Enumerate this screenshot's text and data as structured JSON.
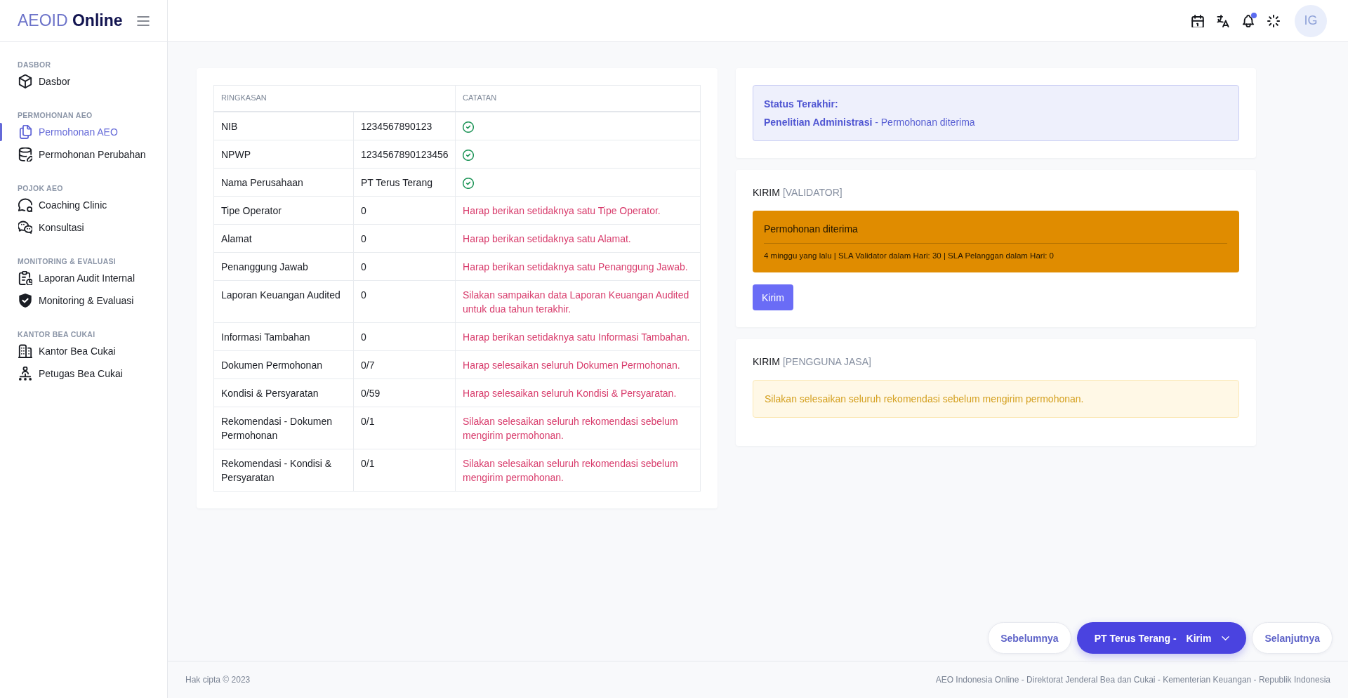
{
  "sidebar": {
    "logo": "AEOID **Online**",
    "sections": [
      {
        "title": "DASBOR",
        "items": [
          {
            "label": "Dasbor",
            "selected": false
          }
        ]
      },
      {
        "title": "PERMOHONAN AEO",
        "items": [
          {
            "label": "Permohonan AEO",
            "selected": true
          },
          {
            "label": "Permohonan Perubahan",
            "selected": false
          }
        ]
      },
      {
        "title": "POJOK AEO",
        "items": [
          {
            "label": "Coaching Clinic",
            "selected": false
          },
          {
            "label": "Konsultasi",
            "selected": false
          }
        ]
      },
      {
        "title": "MONITORING & EVALUASI",
        "items": [
          {
            "label": "Laporan Audit Internal",
            "selected": false
          },
          {
            "label": "Monitoring & Evaluasi",
            "selected": false
          }
        ]
      },
      {
        "title": "KANTOR BEA CUKAI",
        "items": [
          {
            "label": "Kantor Bea Cukai",
            "selected": false
          },
          {
            "label": "Petugas Bea Cukai",
            "selected": false
          }
        ]
      }
    ]
  },
  "top_bar": {
    "notifications_unread": true,
    "avatar_initials": "IG"
  },
  "summary_table": {
    "columns": [
      "RINGKASAN",
      "CATATAN"
    ],
    "rows": [
      {
        "item": "NIB",
        "value": "1234567890123",
        "valid": true
      },
      {
        "item": "NPWP",
        "value": "1234567890123456",
        "valid": true
      },
      {
        "item": "Nama Perusahaan",
        "value": "PT Terus Terang",
        "valid": true
      },
      {
        "item": "Tipe Operator",
        "value": "0",
        "valid": false,
        "note": "Harap berikan setidaknya satu Tipe Operator."
      },
      {
        "item": "Alamat",
        "value": "0",
        "valid": false,
        "note": "Harap berikan setidaknya satu Alamat."
      },
      {
        "item": "Penanggung Jawab",
        "value": "0",
        "valid": false,
        "note": "Harap berikan setidaknya satu Penanggung Jawab."
      },
      {
        "item": "Laporan Keuangan Audited",
        "value": "0",
        "valid": false,
        "note": "Silakan sampaikan data Laporan Keuangan Audited untuk dua tahun terakhir."
      },
      {
        "item": "Informasi Tambahan",
        "value": "0",
        "valid": false,
        "note": "Harap berikan setidaknya satu Informasi Tambahan."
      },
      {
        "item": "Dokumen Permohonan",
        "value": "0/7",
        "valid": false,
        "note": "Harap selesaikan seluruh Dokumen Permohonan."
      },
      {
        "item": "Kondisi & Persyaratan",
        "value": "0/59",
        "valid": false,
        "note": "Harap selesaikan seluruh Kondisi & Persyaratan."
      },
      {
        "item": "Rekomendasi - Dokumen Permohonan",
        "value": "0/1",
        "valid": false,
        "note": "Silakan selesaikan seluruh rekomendasi sebelum mengirim permohonan."
      },
      {
        "item": "Rekomendasi - Kondisi & Persyaratan",
        "value": "0/1",
        "valid": false,
        "note": "Silakan selesaikan seluruh rekomendasi sebelum mengirim permohonan."
      }
    ]
  },
  "status_card": {
    "title": "Status Terakhir:",
    "status": "**Penelitian Administrasi** - Permohonan diterima"
  },
  "validator_card": {
    "title": "KIRIM",
    "role": "[VALIDATOR]",
    "event": {
      "title": "Permohonan diterima",
      "details": "4 minggu yang lalu | SLA Validator dalam Hari: 30 | SLA Pelanggan dalam Hari: 0"
    },
    "button": "Kirim"
  },
  "service_user_card": {
    "title": "KIRIM",
    "role": "[PENGGUNA JASA]",
    "warning": "Silakan selesaikan seluruh rekomendasi sebelum mengirim permohonan."
  },
  "navigation": {
    "previous": "Sebelumnya",
    "current_company": "PT Terus Terang -",
    "current_step": "Kirim",
    "next": "Selanjutnya"
  },
  "footer": {
    "copyright": "Hak cipta © 2023",
    "credits": "AEO Indonesia Online - Direktorat Jenderal Bea dan Cukai - Kementerian Keuangan - Republik Indonesia"
  }
}
